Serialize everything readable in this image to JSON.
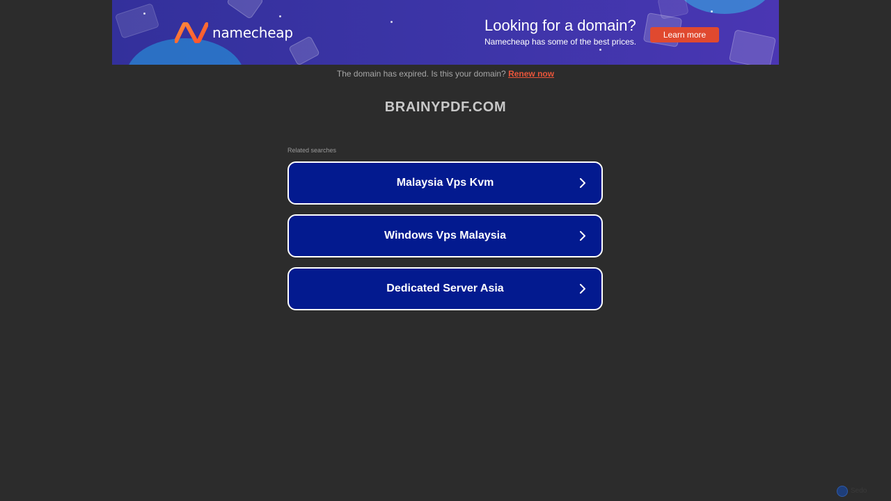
{
  "banner": {
    "brand": "namecheap",
    "title": "Looking for a domain?",
    "subtitle": "Namecheap has some of the best prices.",
    "cta_label": "Learn more",
    "accent_color": "#e0492f",
    "background_color": "#3d35a8"
  },
  "notice": {
    "text": "The domain has expired. Is this your domain?",
    "renew_label": "Renew now",
    "renew_color": "#e8553a"
  },
  "domain_name": "BRAINYPDF.COM",
  "related": {
    "label": "Related searches",
    "items": [
      {
        "label": "Malaysia Vps Kvm",
        "icon": "chevron-right-icon"
      },
      {
        "label": "Windows Vps Malaysia",
        "icon": "chevron-right-icon"
      },
      {
        "label": "Dedicated Server Asia",
        "icon": "chevron-right-icon"
      }
    ],
    "button_color": "#031a8f"
  },
  "footer": {
    "badge_icon": "privacy-badge-icon",
    "badge_text": "Sedo"
  }
}
